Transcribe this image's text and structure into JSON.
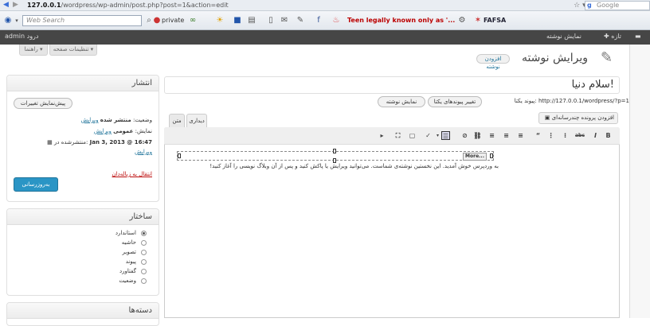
{
  "browser": {
    "url_host": "127.0.0.1",
    "url_path": "/wordpress/wp-admin/post.php?post=1&action=edit",
    "search_engine_placeholder": "Google",
    "toolbar_search_placeholder": "Web Search",
    "private_label": "private",
    "news_item": "Teen legally known only as '...",
    "fafsa_label": "FAFSA"
  },
  "adminbar": {
    "user": "admin",
    "howdy": "درود",
    "site": "نمایش نوشته",
    "new": "تازه"
  },
  "screen_options": {
    "options_label": "تنظیمات صفحه",
    "help_label": "راهنما"
  },
  "heading": {
    "title": "ویرایش نوشته",
    "add_new": "افزودن نوشته"
  },
  "post": {
    "title": "سلام دنیا!",
    "permalink_label": "پیوند یکتا:",
    "permalink_url": "http://127.0.0.1/wordpress/?p=1",
    "change_permalinks": "تغییر پیوندهای یکتا",
    "view_post": "نمایش نوشته",
    "upload_insert": "افزودن پرونده چندرسانه‌ای",
    "tab_visual": "دیداری",
    "tab_html": "متن",
    "content": "به وردپرس خوش آمدید. این نخستین نوشته‌ی شماست. می‌توانید ویرایش یا پاکش کنید و پس از آن وبلاگ نویسی را آغاز کنید!",
    "more_tag": "More..."
  },
  "publish": {
    "title": "انتشار",
    "preview_changes": "پیش‌نمایش تغییرات",
    "status_label": "وضعیت:",
    "status_value": "منتشر شده",
    "edit": "ویرایش",
    "visibility_label": "نمایش:",
    "visibility_value": "عمومی",
    "published_on": "منتشرشده در:",
    "date": "Jan 3, 2013 @ 16:47",
    "trash": "انتقال به زباله‌دان",
    "update": "به‌روزرسانی"
  },
  "format": {
    "title": "ساختار",
    "options": [
      "استاندارد",
      "حاشیه",
      "تصویر",
      "پیوند",
      "گفتاورد",
      "وضعیت"
    ],
    "selected_index": 0
  },
  "categories": {
    "title": "دسته‌ها"
  },
  "colors": {
    "admin_bar": "#464646",
    "link": "#21759b",
    "primary_button": "#2a95c5",
    "trash": "#bc0b0b"
  }
}
